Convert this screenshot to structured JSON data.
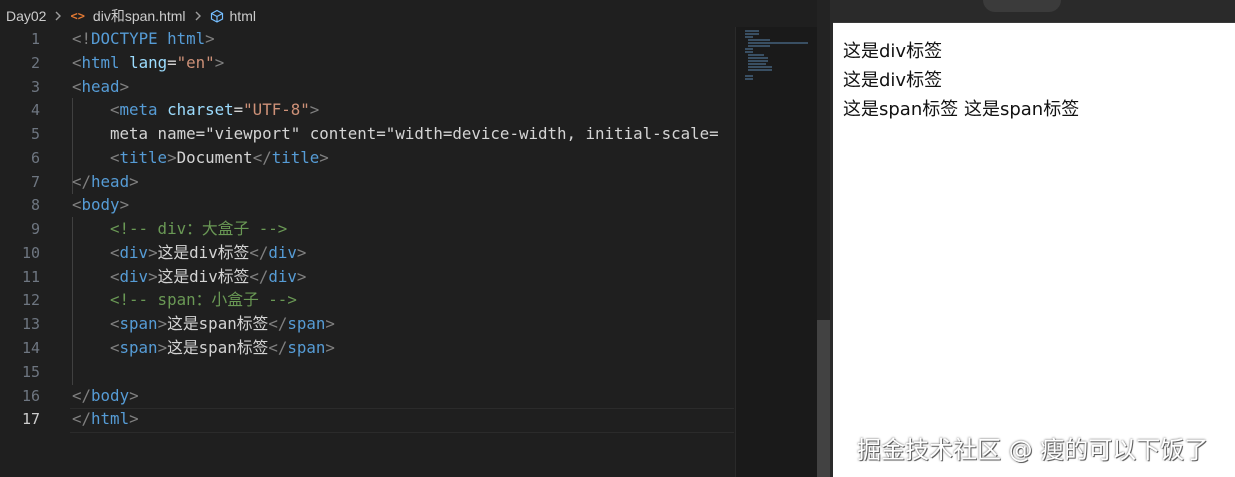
{
  "breadcrumb": {
    "folder": "Day02",
    "file": "div和span.html",
    "symbol": "html"
  },
  "editor": {
    "lines": [
      {
        "num": "1",
        "code": "<!DOCTYPE html>"
      },
      {
        "num": "2",
        "code": "<html lang=\"en\">"
      },
      {
        "num": "3",
        "code": "<head>"
      },
      {
        "num": "4",
        "code": "<meta charset=\"UTF-8\">"
      },
      {
        "num": "5",
        "code": "<meta name=\"viewport\" content=\"width=device-width, initial-scale="
      },
      {
        "num": "6",
        "code": "<title>Document</title>"
      },
      {
        "num": "7",
        "code": "</head>"
      },
      {
        "num": "8",
        "code": "<body>"
      },
      {
        "num": "9",
        "code": "<!-- div：大盒子 -->"
      },
      {
        "num": "10",
        "code": "<div>这是div标签</div>"
      },
      {
        "num": "11",
        "code": "<div>这是div标签</div>"
      },
      {
        "num": "12",
        "code": "<!-- span：小盒子 -->"
      },
      {
        "num": "13",
        "code": "<span>这是span标签</span>"
      },
      {
        "num": "14",
        "code": "<span>这是span标签</span>"
      },
      {
        "num": "15",
        "code": ""
      },
      {
        "num": "16",
        "code": "</body>"
      },
      {
        "num": "17",
        "code": "</html>"
      }
    ]
  },
  "preview": {
    "div1": "这是div标签",
    "div2": "这是div标签",
    "spans": "这是span标签 这是span标签"
  },
  "watermark": "掘金技术社区 @ 瘦的可以下饭了",
  "colors": {
    "editor_bg": "#1f1f1f",
    "tag": "#569cd6",
    "attr": "#9cdcfe",
    "string": "#ce9178",
    "comment": "#6a9955",
    "html_icon": "#e37933"
  }
}
